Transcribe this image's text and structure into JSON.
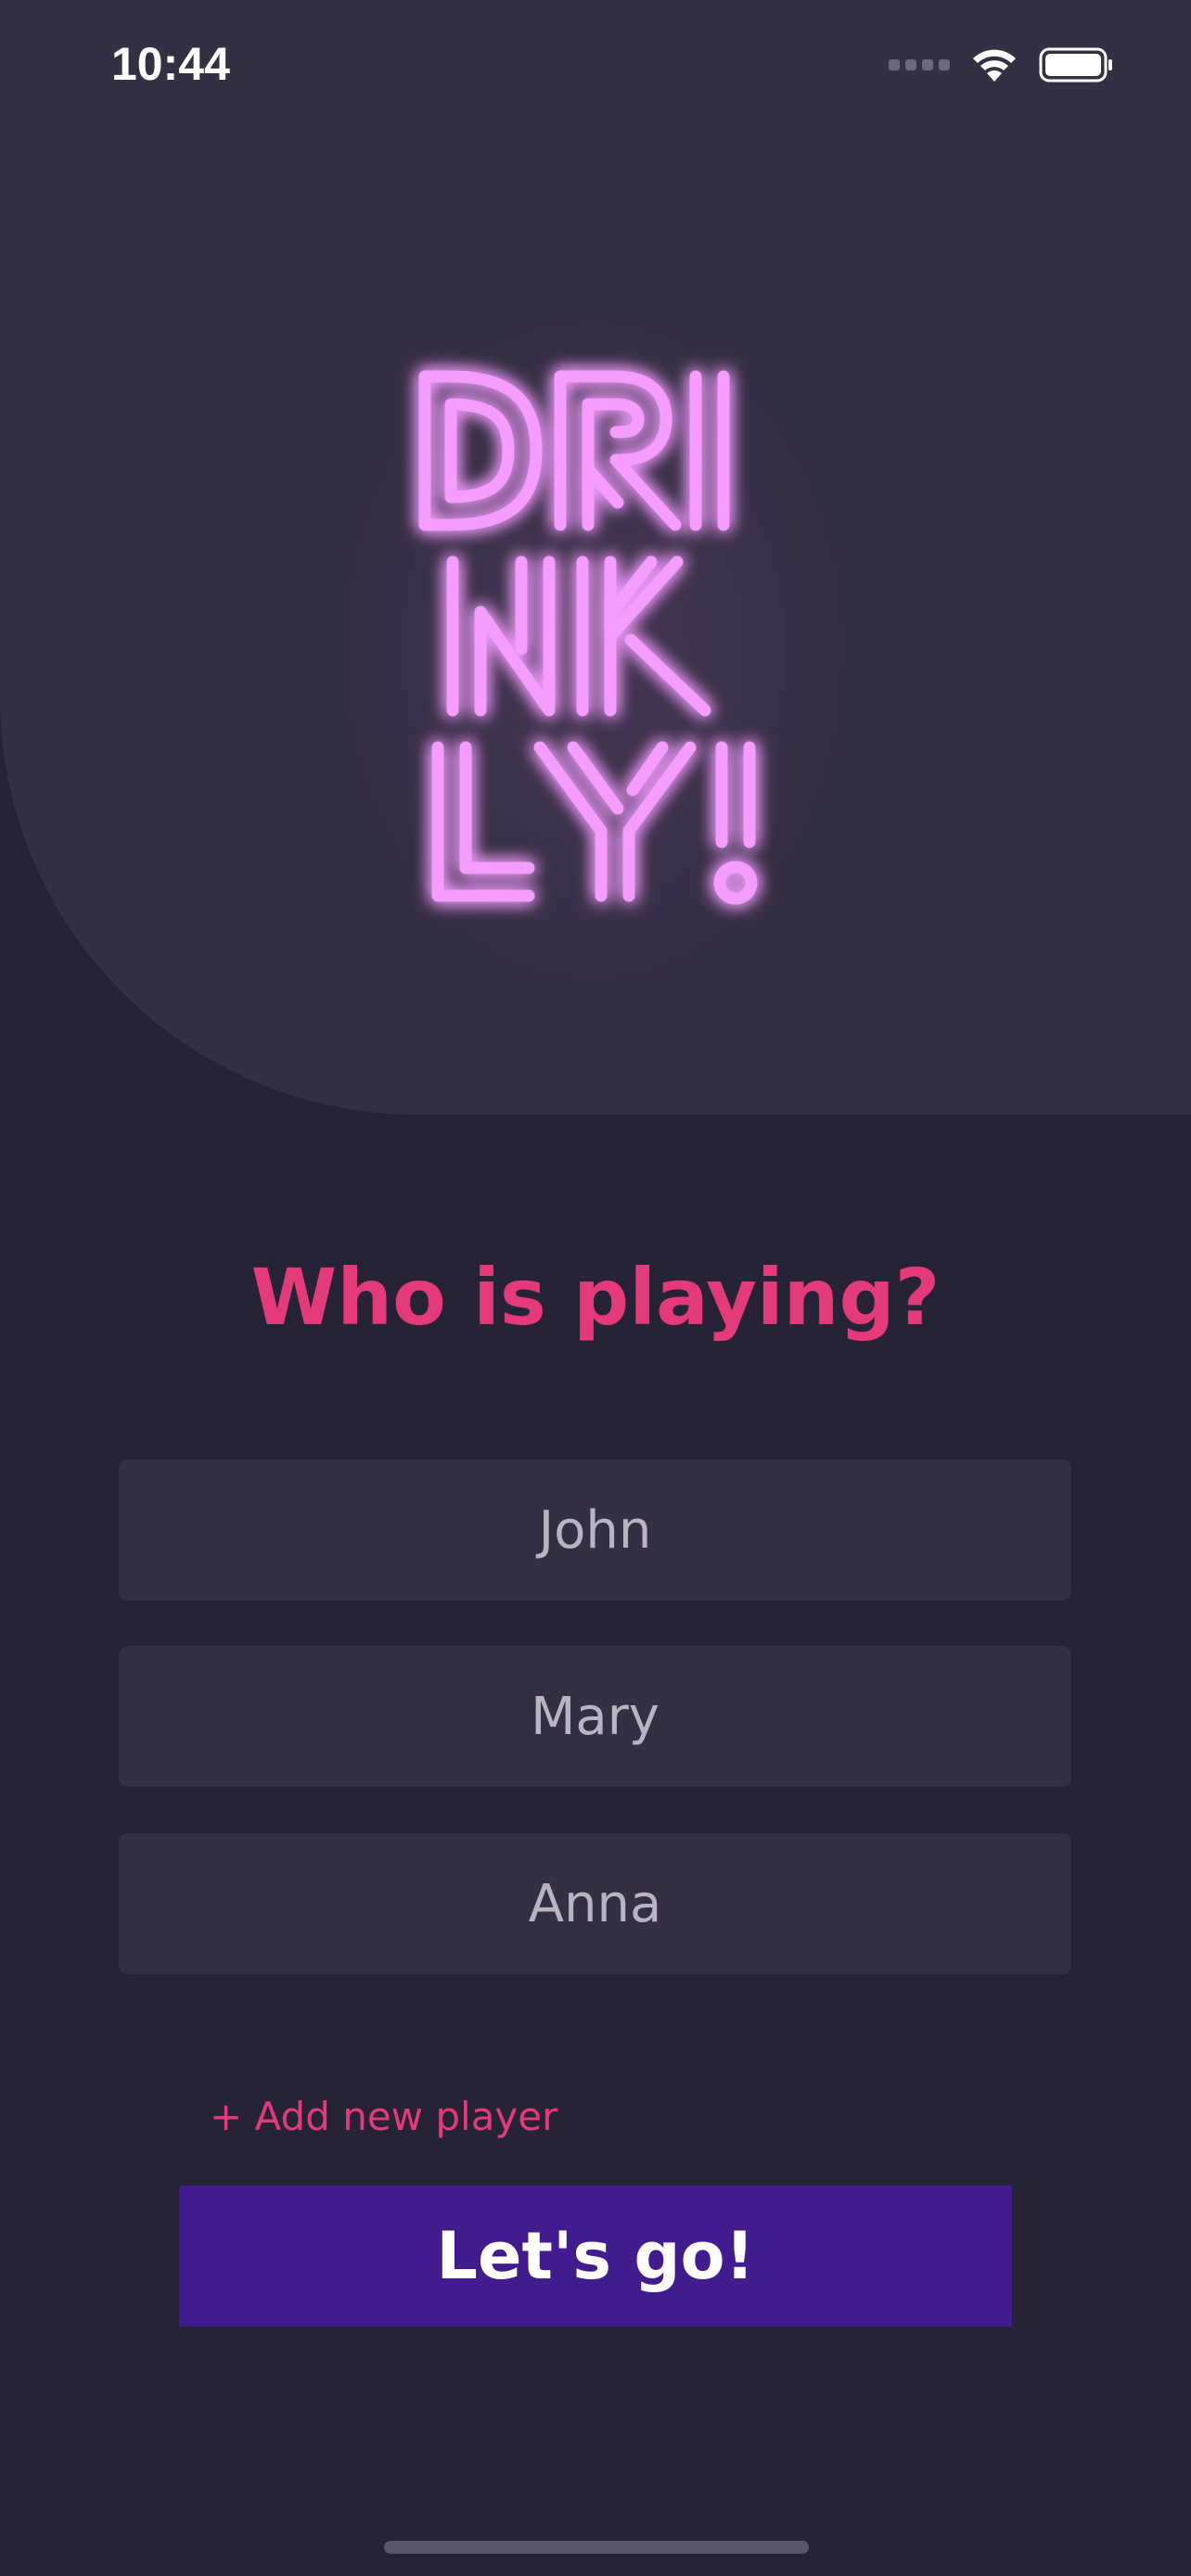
{
  "status_bar": {
    "time": "10:44",
    "signal_icon": "cellular-signal-icon",
    "wifi_icon": "wifi-icon",
    "battery_icon": "battery-icon"
  },
  "logo": {
    "lines": [
      "DRI",
      "NK",
      "LY!"
    ],
    "color": "#f49cff"
  },
  "title": "Who is playing?",
  "players": [
    {
      "value": "John"
    },
    {
      "value": "Mary"
    },
    {
      "value": "Anna"
    }
  ],
  "add_player_label": "+ Add new player",
  "go_button_label": "Let's go!",
  "colors": {
    "background": "#272337",
    "panel": "#352f43",
    "accent": "#e43a7a",
    "button": "#401c8f"
  }
}
